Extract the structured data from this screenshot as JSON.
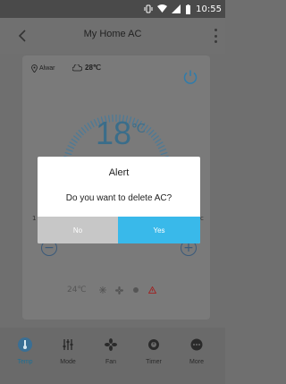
{
  "status_bar": {
    "time": "10:55",
    "icons": [
      "vibrate-icon",
      "wifi-icon",
      "signal-icon",
      "battery-icon"
    ]
  },
  "app_bar": {
    "title": "My Home AC",
    "back_icon": "back-arrow-icon",
    "menu_icon": "more-vert-icon"
  },
  "device": {
    "location": "Alwar",
    "outdoor_temp": "28℃",
    "current_temp": "18",
    "temp_unit": "℃",
    "side_left": "1",
    "side_right": "c",
    "set_temp": "24℃"
  },
  "mode_icons": [
    "snowflake-icon",
    "fan-icon",
    "dot-icon",
    "warning-icon"
  ],
  "tabs": [
    {
      "label": "Temp",
      "icon": "thermometer-icon",
      "active": true
    },
    {
      "label": "Mode",
      "icon": "sliders-icon",
      "active": false
    },
    {
      "label": "Fan",
      "icon": "fan-icon",
      "active": false
    },
    {
      "label": "Timer",
      "icon": "timer-icon",
      "active": false
    },
    {
      "label": "More",
      "icon": "more-horiz-icon",
      "active": false
    }
  ],
  "dialog": {
    "title": "Alert",
    "message": "Do you want to delete AC?",
    "no_label": "No",
    "yes_label": "Yes"
  },
  "colors": {
    "accent": "#39b9ea",
    "active_tab": "#1e6f94",
    "overlay": "#6f6f6f",
    "no_button": "#c7c7c7"
  }
}
